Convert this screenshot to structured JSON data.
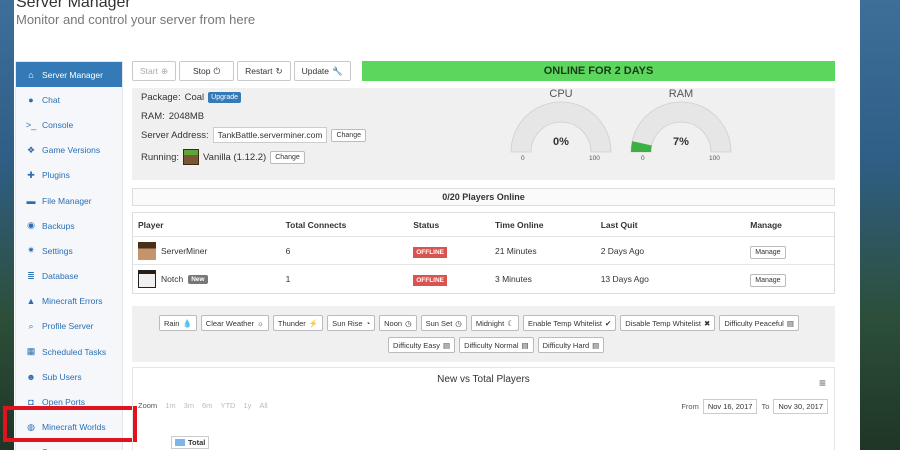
{
  "header": {
    "title": "Server Manager",
    "subtitle": "Monitor and control your server from here"
  },
  "sidebar": {
    "items": [
      {
        "label": "Server Manager",
        "icon": "home-icon",
        "glyph": "⌂",
        "active": true
      },
      {
        "label": "Chat",
        "icon": "chat-icon",
        "glyph": "●"
      },
      {
        "label": "Console",
        "icon": "terminal-icon",
        "glyph": ">_"
      },
      {
        "label": "Game Versions",
        "icon": "cubes-icon",
        "glyph": "❖"
      },
      {
        "label": "Plugins",
        "icon": "puzzle-icon",
        "glyph": "✚"
      },
      {
        "label": "File Manager",
        "icon": "folder-icon",
        "glyph": "▬"
      },
      {
        "label": "Backups",
        "icon": "backup-icon",
        "glyph": "◉"
      },
      {
        "label": "Settings",
        "icon": "gear-icon",
        "glyph": "✷"
      },
      {
        "label": "Database",
        "icon": "database-icon",
        "glyph": "≣"
      },
      {
        "label": "Minecraft Errors",
        "icon": "warning-icon",
        "glyph": "▲"
      },
      {
        "label": "Profile Server",
        "icon": "search-icon",
        "glyph": "⌕"
      },
      {
        "label": "Scheduled Tasks",
        "icon": "calendar-icon",
        "glyph": "▦"
      },
      {
        "label": "Sub Users",
        "icon": "users-icon",
        "glyph": "☻"
      },
      {
        "label": "Open Ports",
        "icon": "unlock-icon",
        "glyph": "◘"
      },
      {
        "label": "Minecraft Worlds",
        "icon": "globe-icon",
        "glyph": "◍"
      },
      {
        "label": "Servers",
        "icon": "chevron-left-icon",
        "glyph": "‹"
      }
    ]
  },
  "toolbar": {
    "start": "Start",
    "stop": "Stop",
    "restart": "Restart",
    "update": "Update",
    "status": "ONLINE FOR 2 DAYS"
  },
  "info": {
    "package_label": "Package:",
    "package_value": "Coal",
    "upgrade": "Upgrade",
    "ram_label": "RAM:",
    "ram_value": "2048MB",
    "address_label": "Server Address:",
    "address_value": "TankBattle.serverminer.com",
    "change": "Change",
    "running_label": "Running:",
    "running_value": "Vanilla (1.12.2)"
  },
  "gauges": {
    "cpu": {
      "title": "CPU",
      "value": 0,
      "label": "0%",
      "min": "0",
      "max": "100"
    },
    "ram": {
      "title": "RAM",
      "value": 7,
      "label": "7%",
      "min": "0",
      "max": "100"
    },
    "fill_color": "#3cb043",
    "track_color": "#e6e6e6"
  },
  "players": {
    "summary": "0/20 Players Online",
    "columns": [
      "Player",
      "Total Connects",
      "Status",
      "Time Online",
      "Last Quit",
      "Manage"
    ],
    "rows": [
      {
        "name": "ServerMiner",
        "badge": "",
        "connects": "6",
        "status": "OFFLINE",
        "time": "21 Minutes",
        "last_quit": "2 Days Ago",
        "manage": "Manage"
      },
      {
        "name": "Notch",
        "badge": "New",
        "connects": "1",
        "status": "OFFLINE",
        "time": "3 Minutes",
        "last_quit": "13 Days Ago",
        "manage": "Manage"
      }
    ]
  },
  "commands": {
    "row1": [
      {
        "label": "Rain",
        "glyph": "💧"
      },
      {
        "label": "Clear Weather",
        "glyph": "☼"
      },
      {
        "label": "Thunder",
        "glyph": "⚡"
      },
      {
        "label": "Sun Rise",
        "glyph": "◔"
      },
      {
        "label": "Noon",
        "glyph": "◷"
      },
      {
        "label": "Sun Set",
        "glyph": "◷"
      },
      {
        "label": "Midnight",
        "glyph": "☾"
      },
      {
        "label": "Enable Temp Whitelist",
        "glyph": "✔"
      },
      {
        "label": "Disable Temp Whitelist",
        "glyph": "✖"
      },
      {
        "label": "Difficulty Peaceful",
        "glyph": "▤"
      }
    ],
    "row2": [
      {
        "label": "Difficulty Easy",
        "glyph": "▤"
      },
      {
        "label": "Difficulty Normal",
        "glyph": "▤"
      },
      {
        "label": "Difficulty Hard",
        "glyph": "▤"
      }
    ]
  },
  "chart": {
    "title": "New vs Total Players",
    "zoom_label": "Zoom",
    "zoom_options": [
      "1m",
      "3m",
      "6m",
      "YTD",
      "1y",
      "All"
    ],
    "from_label": "From",
    "from_value": "Nov 16, 2017",
    "to_label": "To",
    "to_value": "Nov 30, 2017",
    "legend": "Total"
  }
}
